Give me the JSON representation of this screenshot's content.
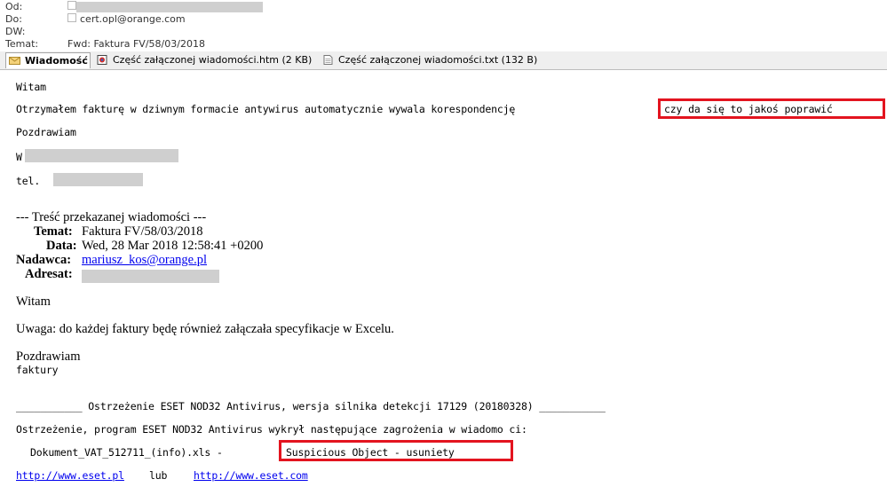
{
  "header": {
    "from_label": "Od:",
    "to_label": "Do:",
    "to_value": "cert.opl@orange.com",
    "cc_label": "DW:",
    "subject_label": "Temat:",
    "subject_value": "Fwd: Faktura FV/58/03/2018"
  },
  "tabs": [
    {
      "label": "Wiadomość",
      "icon": "envelope-icon"
    },
    {
      "label": "Część załączonej wiadomości.htm (2 KB)",
      "icon": "html-file-icon"
    },
    {
      "label": "Część załączonej wiadomości.txt (132 B)",
      "icon": "text-file-icon"
    }
  ],
  "message": {
    "greeting": "Witam",
    "line1": "Otrzymałem fakturę w dziwnym formacie antywirus automatycznie wywala korespondencję",
    "line1_highlight": "czy da się to jakoś poprawić",
    "regards": "Pozdrawiam",
    "sign_initial": "W",
    "tel_label": "tel.",
    "fwd_header": "--- Treść przekazanej wiadomości ---",
    "fwd_subject_label": "Temat:",
    "fwd_subject_value": "Faktura FV/58/03/2018",
    "fwd_date_label": "Data:",
    "fwd_date_value": "Wed, 28 Mar 2018 12:58:41 +0200",
    "fwd_sender_label": "Nadawca:",
    "fwd_sender_value": "mariusz_kos@orange.pl",
    "fwd_recipient_label": "Adresat:",
    "fwd_greeting": "Witam",
    "fwd_note": "Uwaga: do każdej faktury będę również załączała specyfikacje w Excelu.",
    "fwd_regards": "Pozdrawiam",
    "fwd_footer": "faktury",
    "eset_title": "___________ Ostrzeżenie ESET NOD32 Antivirus, wersja silnika detekcji 17129 (20180328) ___________",
    "eset_warning": "Ostrzeżenie, program ESET NOD32 Antivirus wykrył następujące zagrożenia w wiadomo ci:",
    "eset_file": "Dokument_VAT_512711_(info).xls -",
    "eset_result": "Suspicious Object - usuniety",
    "link1": "http://www.eset.pl",
    "link_sep": "lub",
    "link2": "http://www.eset.com"
  },
  "colors": {
    "highlight": "#e3141f",
    "link": "#0000ee",
    "redaction": "#cfcfcf"
  }
}
